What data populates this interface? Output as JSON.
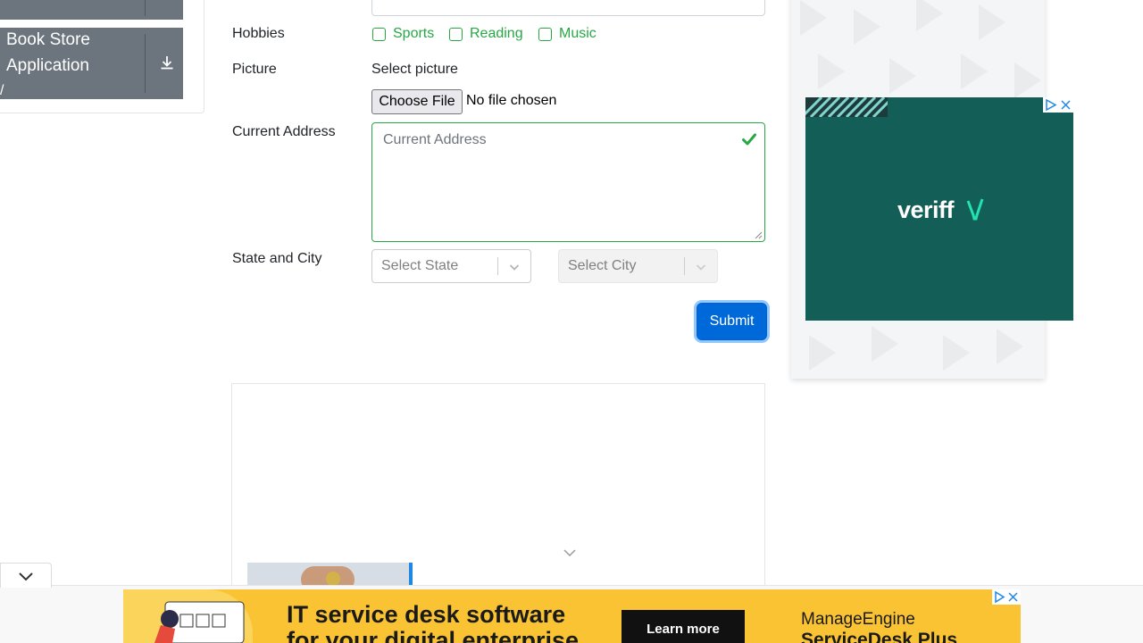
{
  "sidebar": {
    "items": [
      {
        "label": "",
        "icon": "download-icon"
      },
      {
        "label": "Book Store Application",
        "lead_glyph": "/",
        "icon": "download-icon"
      }
    ]
  },
  "form": {
    "hobbies": {
      "label": "Hobbies",
      "options": [
        "Sports",
        "Reading",
        "Music"
      ]
    },
    "picture": {
      "label": "Picture",
      "prompt": "Select picture",
      "button_label": "Choose File",
      "status": "No file chosen"
    },
    "address": {
      "label": "Current Address",
      "placeholder": "Current Address"
    },
    "state_city": {
      "label": "State and City",
      "state_placeholder": "Select State",
      "city_placeholder": "Select City"
    },
    "submit_label": "Submit"
  },
  "ads": {
    "right": {
      "brand": "veriff"
    },
    "bottom": {
      "headline_line1": "IT service desk software",
      "headline_line2": "for your digital enterprise",
      "cta": "Learn more",
      "brand": "ManageEngine",
      "product": "ServiceDesk Plus"
    }
  },
  "colors": {
    "valid_green": "#28a745",
    "primary_blue": "#0069d9",
    "sidebar_gray": "#6c757d",
    "veriff_teal": "#135e56",
    "bottom_ad_yellow": "#f9c333"
  }
}
